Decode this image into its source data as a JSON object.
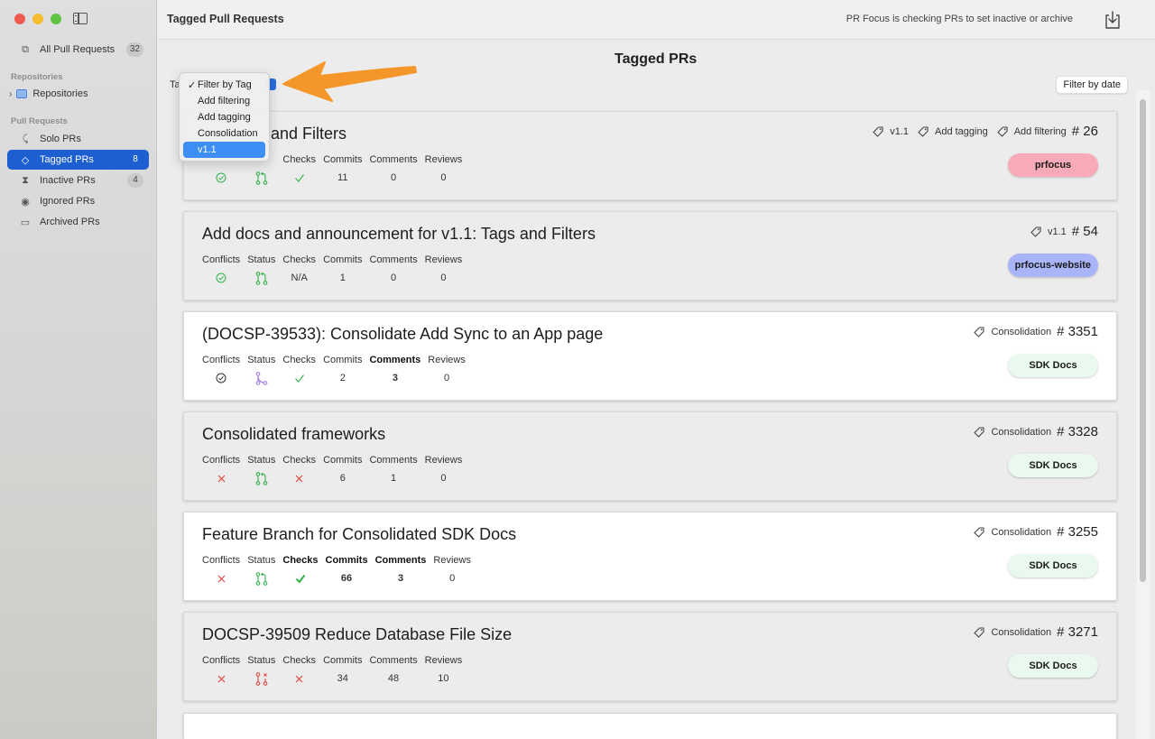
{
  "window": {
    "header_title": "Tagged Pull Requests",
    "status_text": "PR Focus is checking PRs to set inactive or archive"
  },
  "sidebar": {
    "all_prs": {
      "label": "All Pull Requests",
      "count": "32"
    },
    "repositories_section": "Repositories",
    "repositories_item": "Repositories",
    "pull_requests_section": "Pull Requests",
    "items": [
      {
        "label": "Solo PRs",
        "count": null,
        "icon": "solo-icon",
        "glyph": "⤹"
      },
      {
        "label": "Tagged PRs",
        "count": "8",
        "icon": "tag-icon",
        "glyph": "◇"
      },
      {
        "label": "Inactive PRs",
        "count": "4",
        "icon": "hourglass-icon",
        "glyph": "⧗"
      },
      {
        "label": "Ignored PRs",
        "count": null,
        "icon": "eye-slash-icon",
        "glyph": "◉"
      },
      {
        "label": "Archived PRs",
        "count": null,
        "icon": "archive-icon",
        "glyph": "▭"
      }
    ]
  },
  "main": {
    "title": "Tagged PRs",
    "tag_label": "Ta",
    "filter_date_label": "Filter by date"
  },
  "dropdown": {
    "items": [
      {
        "label": "Filter by Tag",
        "checked": true,
        "highlighted": false
      },
      {
        "label": "Add filtering",
        "checked": false,
        "highlighted": false
      },
      {
        "label": "Add tagging",
        "checked": false,
        "highlighted": false
      },
      {
        "label": "Consolidation",
        "checked": false,
        "highlighted": false
      },
      {
        "label": "v1.1",
        "checked": false,
        "highlighted": true
      }
    ]
  },
  "stat_labels": [
    "Conflicts",
    "Status",
    "Checks",
    "Commits",
    "Comments",
    "Reviews"
  ],
  "colors": {
    "ok": "#33b14a",
    "bad": "#e0473f",
    "merged": "#a07ee0",
    "accent": "#1d5fd1",
    "arrow": "#f5962a"
  },
  "prs": [
    {
      "title": "Add tags and Filters",
      "visible_title": "and Filters",
      "number": "# 26",
      "tags": [
        "v1.1",
        "Add tagging",
        "Add filtering"
      ],
      "repo": "prfocus",
      "repo_color": "#f9aab8",
      "white": false,
      "bold": [],
      "conflicts": "ok",
      "status": "open-ok",
      "checks": "ok",
      "checks_text": "",
      "commits": "11",
      "comments": "0",
      "reviews": "0"
    },
    {
      "title": "Add docs and announcement for v1.1: Tags and Filters",
      "number": "# 54",
      "tags": [
        "v1.1"
      ],
      "repo": "prfocus-website",
      "repo_color": "#aab4f8",
      "white": false,
      "bold": [],
      "conflicts": "ok",
      "status": "open-ok",
      "checks": "text",
      "checks_text": "N/A",
      "commits": "1",
      "comments": "0",
      "reviews": "0"
    },
    {
      "title": "(DOCSP-39533): Consolidate Add Sync to an App page",
      "number": "# 3351",
      "tags": [
        "Consolidation"
      ],
      "repo": "SDK Docs",
      "repo_color": "#e9f9ef",
      "white": true,
      "bold": [
        "Comments"
      ],
      "conflicts": "neutral",
      "status": "merged",
      "checks": "ok",
      "checks_text": "",
      "commits": "2",
      "comments": "3",
      "reviews": "0"
    },
    {
      "title": "Consolidated frameworks",
      "number": "# 3328",
      "tags": [
        "Consolidation"
      ],
      "repo": "SDK Docs",
      "repo_color": "#e9f9ef",
      "white": false,
      "bold": [],
      "conflicts": "bad",
      "status": "open-ok",
      "checks": "bad",
      "checks_text": "",
      "commits": "6",
      "comments": "1",
      "reviews": "0"
    },
    {
      "title": "Feature Branch for Consolidated SDK Docs",
      "number": "# 3255",
      "tags": [
        "Consolidation"
      ],
      "repo": "SDK Docs",
      "repo_color": "#e9f9ef",
      "white": true,
      "bold": [
        "Checks",
        "Commits",
        "Comments"
      ],
      "conflicts": "bad",
      "status": "open-ok",
      "checks": "ok-bold",
      "checks_text": "",
      "commits": "66",
      "comments": "3",
      "reviews": "0"
    },
    {
      "title": "DOCSP-39509 Reduce Database File Size",
      "number": "# 3271",
      "tags": [
        "Consolidation"
      ],
      "repo": "SDK Docs",
      "repo_color": "#e9f9ef",
      "white": false,
      "bold": [],
      "conflicts": "bad",
      "status": "closed",
      "checks": "bad",
      "checks_text": "",
      "commits": "34",
      "comments": "48",
      "reviews": "10"
    }
  ]
}
